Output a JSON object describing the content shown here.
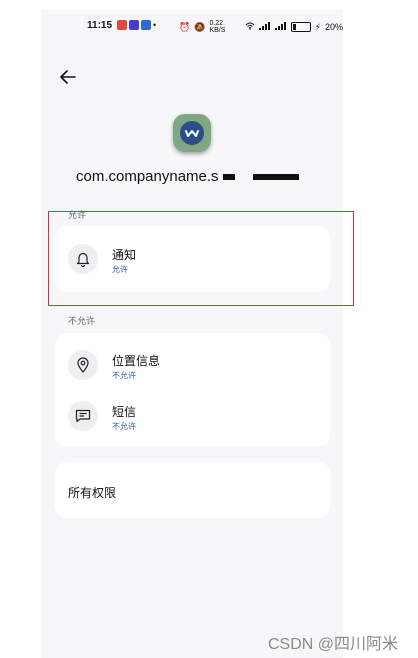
{
  "status_bar": {
    "time": "11:15",
    "net_speed": "0.22 KB/S",
    "battery_percent": 20,
    "battery_text": "20%",
    "app_colors": [
      "#e04a3a",
      "#4a3ad0",
      "#2d6ad8"
    ]
  },
  "app": {
    "package_name": "com.companyname.s"
  },
  "sections": {
    "allowed_label": "允许",
    "denied_label": "不允许"
  },
  "permissions": {
    "allowed": [
      {
        "name": "通知",
        "status": "允许",
        "icon": "bell-icon"
      }
    ],
    "denied": [
      {
        "name": "位置信息",
        "status": "不允许",
        "icon": "location-pin-icon"
      },
      {
        "name": "短信",
        "status": "不允许",
        "icon": "message-icon"
      }
    ]
  },
  "all_permissions_label": "所有权限",
  "watermark": "CSDN @四川阿米",
  "colors": {
    "accent_blue": "#2b56b8",
    "highlight_red": "#d9303a",
    "app_icon_green": "#7fa783"
  }
}
